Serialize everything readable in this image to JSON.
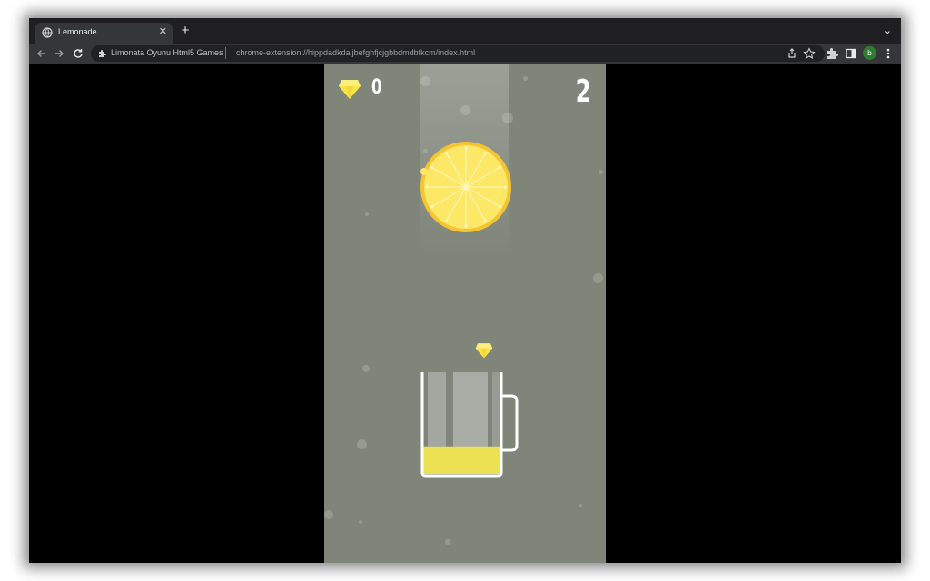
{
  "browser": {
    "tab_title": "Lemonade",
    "tab_close_glyph": "✕",
    "new_tab_glyph": "+",
    "tab_menu_glyph": "⌄",
    "site_name": "Limonata Oyunu Html5 Games",
    "url": "chrome-extension://hippdadkdaljbefghfjcjgbbdmdbfkcm/index.html",
    "profile_initial": "b"
  },
  "game": {
    "gem_count": "0",
    "score": "2",
    "cup_fill_level": 0.27,
    "icons": {
      "counter": "diamond-icon",
      "pickup": "diamond-icon",
      "fruit": "lemon-slice",
      "container": "glass-mug"
    },
    "colors": {
      "background": "#80857a",
      "lemon_rind": "#f5c431",
      "lemon_flesh": "#fde767",
      "gem": "#f8e44a",
      "lemonade": "#ebe153",
      "cup_outline": "#ffffff"
    }
  }
}
